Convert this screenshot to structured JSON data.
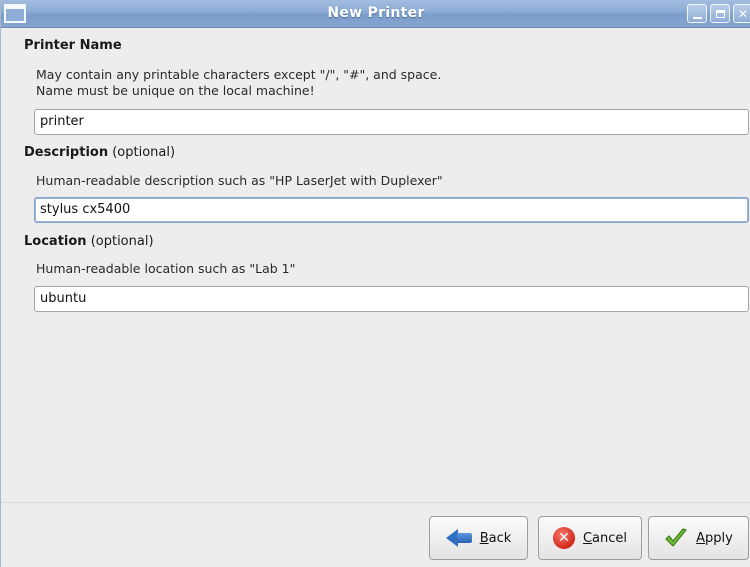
{
  "window": {
    "title": "New Printer",
    "close_glyph": "✕"
  },
  "printer_name": {
    "heading": "Printer Name",
    "heading_suffix": "",
    "hint_line1": "May contain any printable characters except \"/\", \"#\", and space.",
    "hint_line2": "Name must be unique on the local machine!",
    "value": "printer"
  },
  "description": {
    "heading": "Description",
    "heading_suffix": " (optional)",
    "hint": "Human-readable description such as \"HP LaserJet with Duplexer\"",
    "value": "stylus cx5400"
  },
  "location": {
    "heading": "Location",
    "heading_suffix": " (optional)",
    "hint": "Human-readable location such as \"Lab 1\"",
    "value": "ubuntu"
  },
  "buttons": {
    "back_mnemonic": "B",
    "back_rest": "ack",
    "cancel_mnemonic": "C",
    "cancel_rest": "ancel",
    "apply_mnemonic": "A",
    "apply_rest": "pply"
  },
  "icons": {
    "window_menu": "window-menu-icon",
    "minimize": "minimize-icon",
    "maximize": "maximize-icon",
    "close": "close-icon",
    "back": "back-arrow-icon",
    "cancel": "cancel-icon",
    "apply": "checkmark-icon"
  },
  "colors": {
    "titlebar": "#8aaad4",
    "focus_border": "#86a3c8",
    "cancel_red": "#d3281a",
    "apply_green": "#5aa52a",
    "back_blue": "#2f6fc1"
  }
}
